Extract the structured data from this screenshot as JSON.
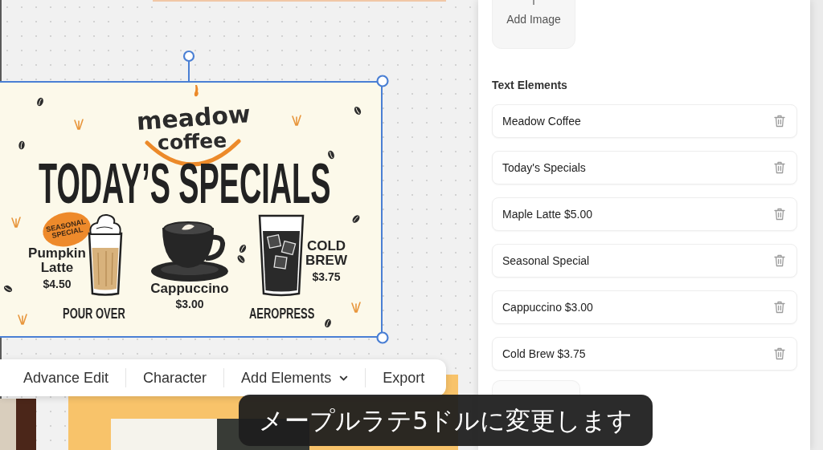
{
  "canvas": {
    "poster": {
      "brand_lines": [
        "meadow",
        "coffee"
      ],
      "headline": "TODAY’S SPECIALS",
      "badge": "SEASONAL SPECIAL",
      "items": [
        {
          "kind": "latte",
          "name": "Pumpkin Latte",
          "price": "$4.50"
        },
        {
          "kind": "cup",
          "name": "Cappuccino",
          "price": "$3.00"
        },
        {
          "kind": "iced",
          "name": "COLD BREW",
          "price": "$3.75"
        }
      ],
      "labels": [
        "POUR OVER",
        "AEROPRESS"
      ]
    },
    "toolbar": [
      {
        "label": "Advance Edit",
        "dropdown": false
      },
      {
        "label": "Character",
        "dropdown": false
      },
      {
        "label": "Add Elements",
        "dropdown": true
      },
      {
        "label": "Export",
        "dropdown": false
      }
    ]
  },
  "panel": {
    "add_image": "Add Image",
    "section_title": "Text Elements",
    "text_elements": [
      "Meadow Coffee",
      "Today's Specials",
      "Maple Latte $5.00",
      "Seasonal Special",
      "Cappuccino $3.00",
      "Cold Brew $3.75"
    ]
  },
  "subtitle": "メープルラテ5ドルに変更します"
}
